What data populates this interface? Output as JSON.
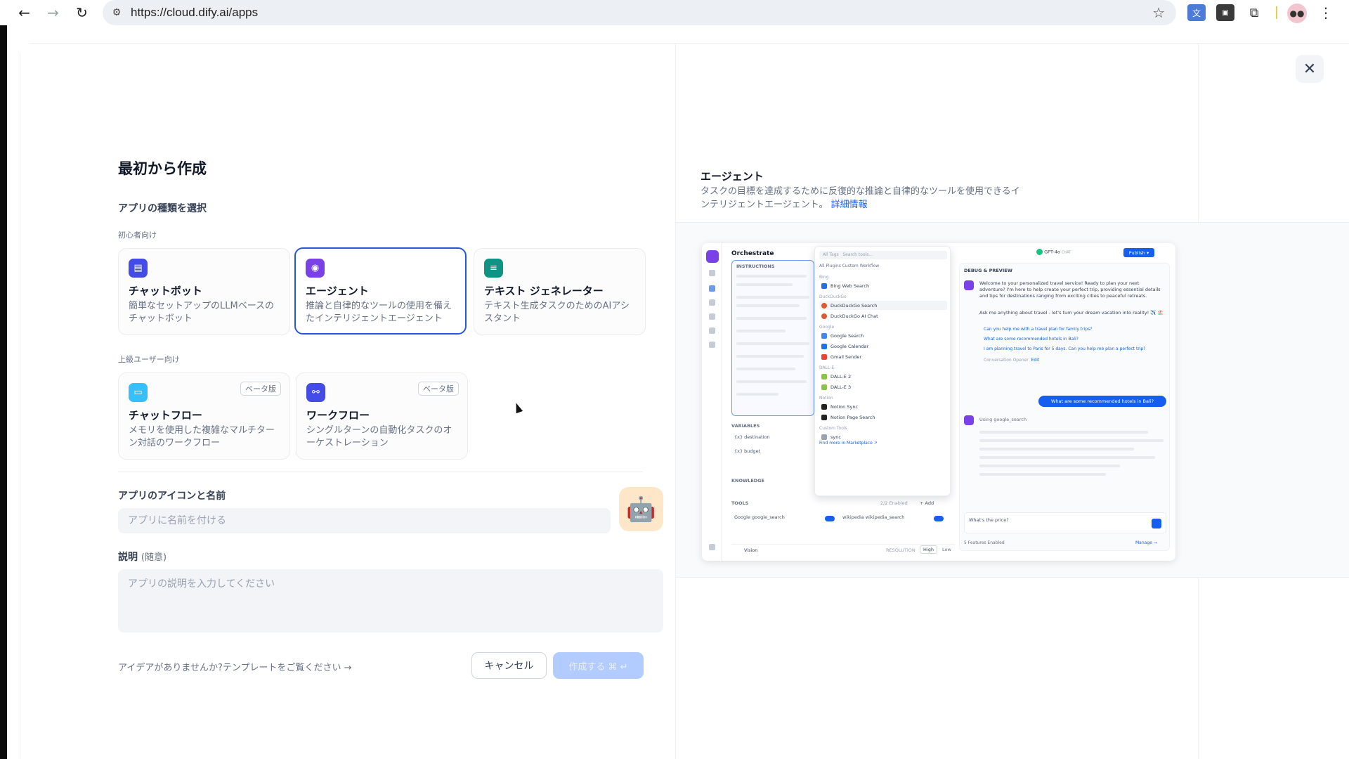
{
  "browser": {
    "url": "https://cloud.dify.ai/apps",
    "icons": [
      "back-icon",
      "forward-icon",
      "reload-icon",
      "site-settings-icon",
      "bookmark-star-icon",
      "translate-extension-icon",
      "screen-extension-icon",
      "extensions-puzzle-icon",
      "profile-avatar-icon",
      "more-menu-icon"
    ]
  },
  "modal": {
    "close_icon": "close-icon",
    "left": {
      "title": "最初から作成",
      "app_type_heading": "アプリの種類を選択",
      "beginner_label": "初心者向け",
      "advanced_label": "上級ユーザー向け",
      "beginner_types": [
        {
          "name": "チャットボット",
          "desc": "簡単なセットアップのLLMベースのチャットボット",
          "icon": "chatbot-icon",
          "color": "#444ce7"
        },
        {
          "name": "エージェント",
          "desc": "推論と自律的なツールの使用を備えたインテリジェントエージェント",
          "icon": "agent-icon",
          "color": "#7a42e6",
          "selected": true
        },
        {
          "name": "テキスト ジェネレーター",
          "desc": "テキスト生成タスクのためのAIアシスタント",
          "icon": "text-generator-icon",
          "color": "#0e9384"
        }
      ],
      "advanced_types": [
        {
          "name": "チャットフロー",
          "desc": "メモリを使用した複雑なマルチターン対話のワークフロー",
          "icon": "chatflow-icon",
          "color": "#36bffa",
          "badge": "ベータ版"
        },
        {
          "name": "ワークフロー",
          "desc": "シングルターンの自動化タスクのオーケストレーション",
          "icon": "workflow-icon",
          "color": "#444ce7",
          "badge": "ベータ版"
        }
      ],
      "name_section": {
        "label": "アプリのアイコンと名前",
        "placeholder": "アプリに名前を付ける",
        "value": "",
        "avatar": "🤖"
      },
      "desc_section": {
        "label": "説明",
        "optional": "(随意)",
        "placeholder": "アプリの説明を入力してください",
        "value": ""
      },
      "template_link": "アイデアがありませんか?テンプレートをご覧ください →",
      "cancel_label": "キャンセル",
      "create_label": "作成する ⌘ ↵"
    },
    "right": {
      "title": "エージェント",
      "desc": "タスクの目標を達成するために反復的な推論と自律的なツールを使用できるインテリジェントエージェント。",
      "more_link": "詳細情報",
      "preview": {
        "orchestrate": "Orchestrate",
        "instructions": "INSTRUCTIONS",
        "variables": "VARIABLES",
        "var1": "{x} destination",
        "var2": "{x} budget",
        "knowledge": "KNOWLEDGE",
        "tools": "TOOLS",
        "tools_enabled": "2/2 Enabled",
        "tools_add": "+ Add",
        "tool1": "Google  google_search",
        "tool2": "wikipedia  wikipedia_search",
        "vision": "Vision",
        "resolution": "RESOLUTION",
        "res_high": "High",
        "res_low": "Low",
        "menu_search": "Search tools...",
        "menu_tags": "All Tags",
        "menu_tabs": "All   Plugins   Custom   Workflow",
        "groups": {
          "bing": "Bing",
          "duck": "DuckDuckGo",
          "google": "Google",
          "dalle": "DALL-E",
          "notion": "Notion",
          "custom": "Custom Tools"
        },
        "items": {
          "bing": "Bing Web Search",
          "duck1": "DuckDuckGo Search",
          "duck2": "DuckDuckGo AI Chat",
          "g1": "Google Search",
          "g2": "Google Calendar",
          "g3": "Gmail Sender",
          "d1": "DALL-E 2",
          "d2": "DALL-E 3",
          "n1": "Notion Sync",
          "n2": "Notion Page Search",
          "c1": "sync"
        },
        "marketplace": "Find more in Marketplace ↗",
        "model": "GPT-4o",
        "model_tag": "CHAT",
        "publish": "Publish ▾",
        "debug": "DEBUG & PREVIEW",
        "welcome": "Welcome to your personalized travel service! Ready to plan your next adventure? I'm here to help create your perfect trip, providing essential details and tips for destinations ranging from exciting cities to peaceful retreats.",
        "ask": "Ask me anything about travel - let's turn your dream vacation into reality! ✈️ 🏖️",
        "sug1": "Can you help me with a travel plan for family trips?",
        "sug2": "What are some recommended hotels in Bali?",
        "sug3": "I am planning travel to Paris for 5 days. Can you help me plan a perfect trip?",
        "opener": "Conversation Opener",
        "edit": "Edit",
        "user_msg": "What are some recommended hotels in Bali?",
        "using": "Using  google_search",
        "chat_input": "What's the price?",
        "features": "5 Features Enabled",
        "manage": "Manage →"
      }
    }
  }
}
